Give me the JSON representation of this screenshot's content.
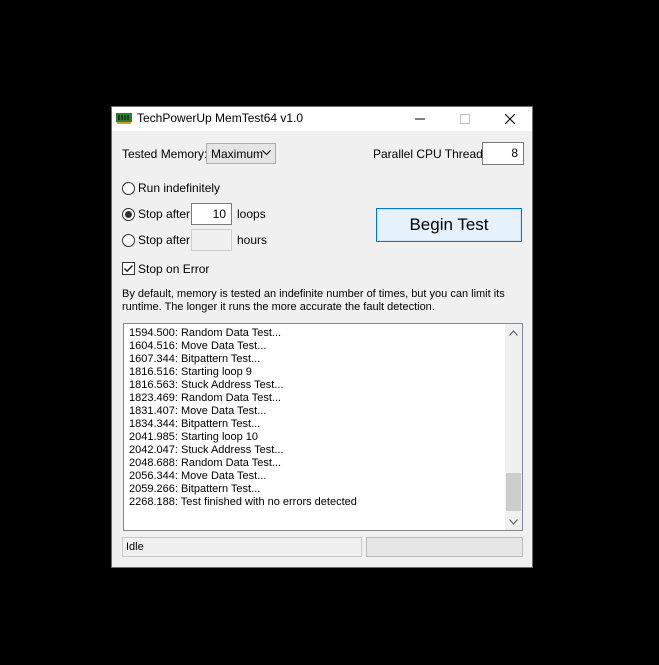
{
  "window": {
    "title": "TechPowerUp MemTest64 v1.0"
  },
  "settings": {
    "tested_memory_label": "Tested Memory:",
    "tested_memory_value": "Maximum",
    "parallel_threads_label": "Parallel CPU Threads:",
    "parallel_threads_value": "8",
    "run_indefinitely_label": "Run indefinitely",
    "stop_after_loops_label": "Stop after",
    "loops_value": "10",
    "loops_unit": "loops",
    "stop_after_hours_label": "Stop after",
    "hours_value": "",
    "hours_unit": "hours",
    "stop_on_error_label": "Stop on Error",
    "stop_on_error_checked": true,
    "selected_mode": "stop_after_loops"
  },
  "begin_button_label": "Begin Test",
  "description": "By default, memory is tested an indefinite number of times, but you can limit its runtime. The longer it runs the more accurate the fault detection.",
  "log": {
    "lines": [
      "1594.500: Random Data Test...",
      "1604.516: Move Data Test...",
      "1607.344: Bitpattern Test...",
      "1816.516: Starting loop 9",
      "1816.563: Stuck Address Test...",
      "1823.469: Random Data Test...",
      "1831.407: Move Data Test...",
      "1834.344: Bitpattern Test...",
      "2041.985: Starting loop 10",
      "2042.047: Stuck Address Test...",
      "2048.688: Random Data Test...",
      "2056.344: Move Data Test...",
      "2059.266: Bitpattern Test...",
      "2268.188: Test finished with no errors detected"
    ]
  },
  "status": {
    "text": "Idle",
    "progress": 0
  },
  "colors": {
    "accent": "#0078d7",
    "button_bg": "#e5f1fb",
    "window_bg": "#f0f0f0",
    "progress_fill": "#06b025"
  },
  "icons": {
    "app": "memory-chip-icon",
    "minimize": "minimize-icon",
    "maximize": "maximize-icon",
    "close": "close-icon",
    "scroll_up": "chevron-up-icon",
    "scroll_down": "chevron-down-icon",
    "dropdown": "chevron-down-icon"
  }
}
